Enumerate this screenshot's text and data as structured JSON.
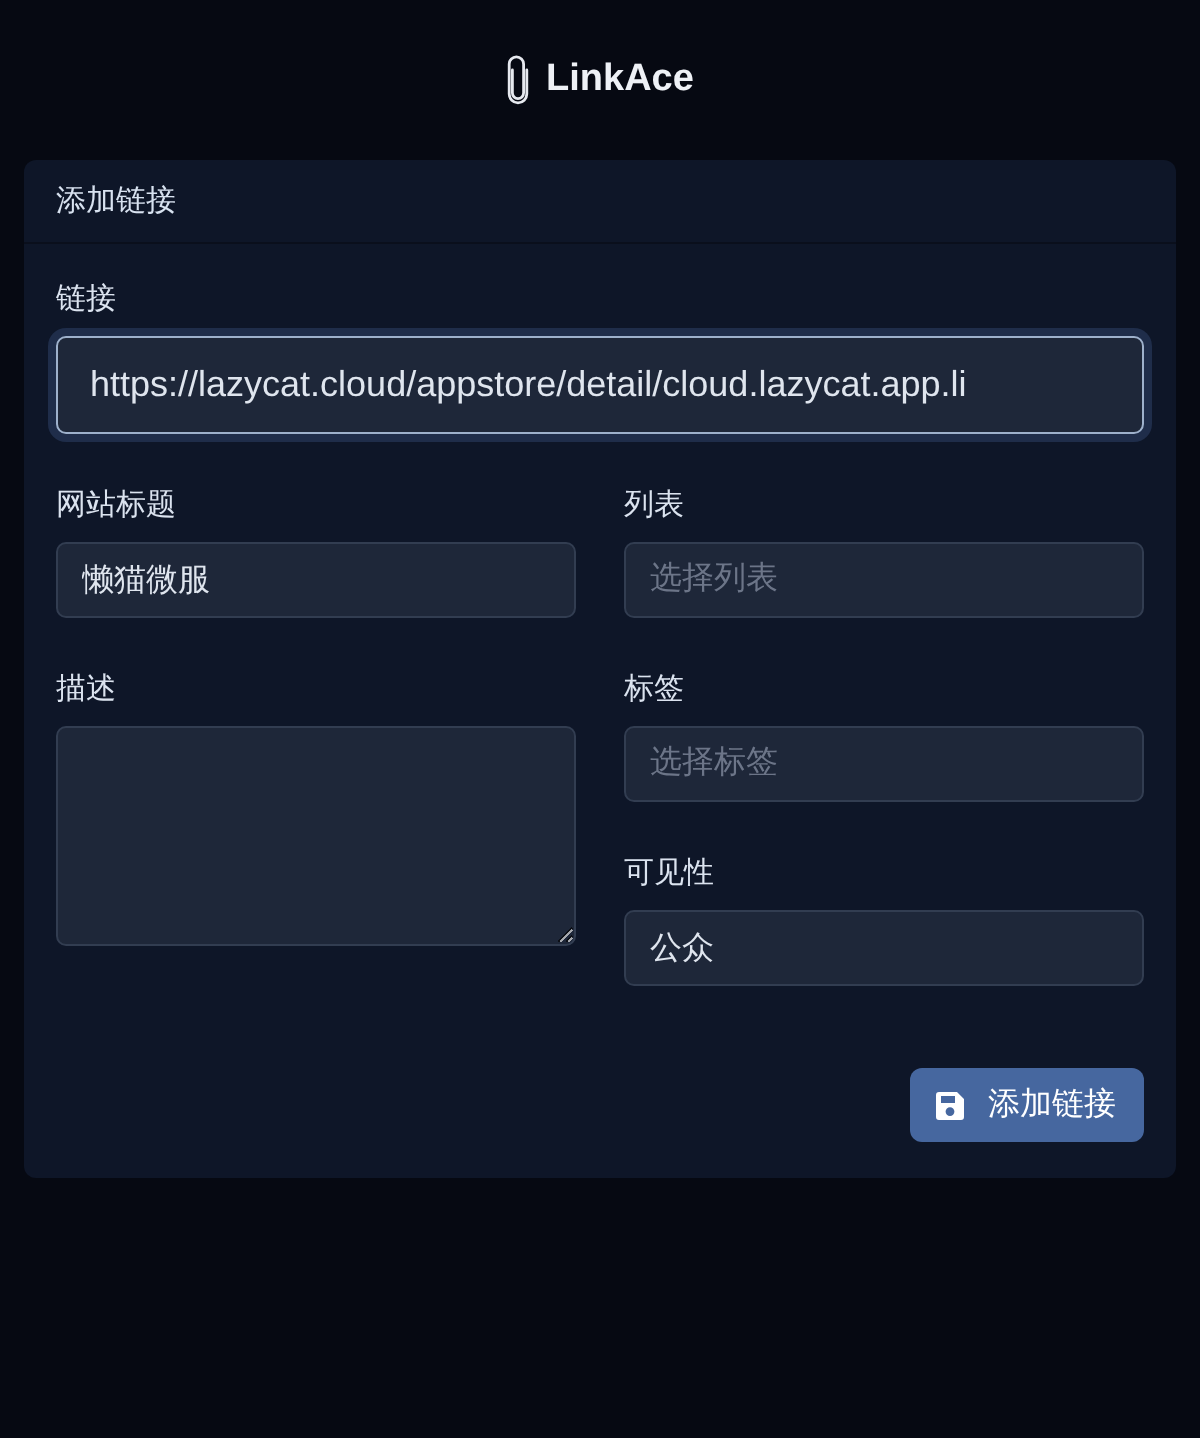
{
  "header": {
    "logo_text": "LinkAce"
  },
  "card": {
    "title": "添加链接"
  },
  "form": {
    "url": {
      "label": "链接",
      "value": "https://lazycat.cloud/appstore/detail/cloud.lazycat.app.li",
      "focused": true
    },
    "title_field": {
      "label": "网站标题",
      "value": "懒猫微服"
    },
    "lists": {
      "label": "列表",
      "placeholder": "选择列表"
    },
    "description": {
      "label": "描述"
    },
    "tags": {
      "label": "标签",
      "placeholder": "选择标签"
    },
    "visibility": {
      "label": "可见性",
      "value": "公众"
    },
    "submit": {
      "label": "添加链接"
    }
  }
}
